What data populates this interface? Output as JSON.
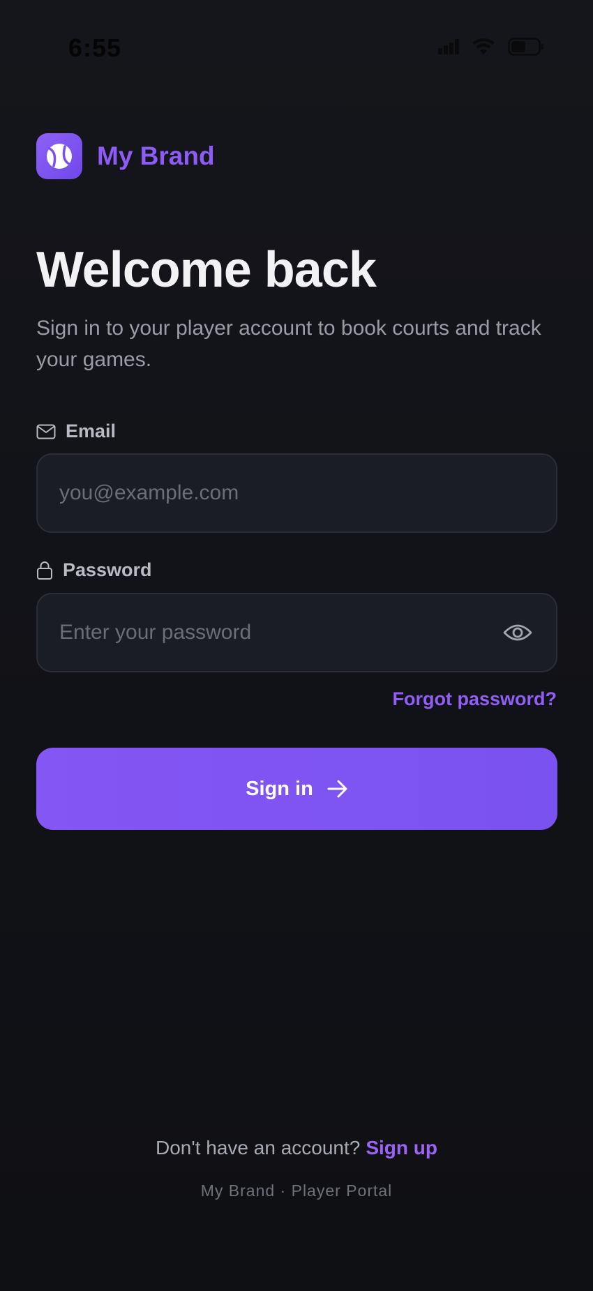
{
  "status_bar": {
    "time": "6:55",
    "icons": [
      "signal-icon",
      "wifi-icon",
      "battery-icon"
    ]
  },
  "brand": {
    "name": "My Brand",
    "logo_icon": "tennis-ball-icon",
    "accent_color": "#8d5cf6"
  },
  "header": {
    "title": "Welcome back",
    "subtitle": "Sign in to your player account to book courts and track your games."
  },
  "form": {
    "email": {
      "label": "Email",
      "icon": "mail-icon",
      "placeholder": "you@example.com",
      "value": ""
    },
    "password": {
      "label": "Password",
      "icon": "lock-icon",
      "placeholder": "Enter your password",
      "value": "",
      "toggle_icon": "eye-icon"
    },
    "forgot_label": "Forgot password?",
    "submit_label": "Sign in",
    "submit_icon": "arrow-right-icon"
  },
  "signup": {
    "prompt": "Don't have an account?",
    "link_label": "Sign up"
  },
  "footer": {
    "text": "My Brand · Player Portal"
  },
  "colors": {
    "background": "#121318",
    "primary": "#7c52f2",
    "input_bg": "#1b1d25",
    "input_border": "#2b2e38"
  }
}
